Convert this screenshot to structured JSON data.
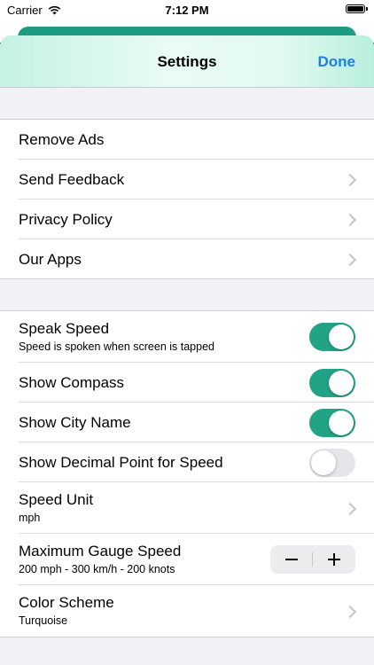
{
  "status_bar": {
    "carrier": "Carrier",
    "time": "7:12 PM"
  },
  "nav": {
    "title": "Settings",
    "done_label": "Done"
  },
  "groups": [
    {
      "items": [
        {
          "title": "Remove Ads",
          "chevron": false
        },
        {
          "title": "Send Feedback",
          "chevron": true
        },
        {
          "title": "Privacy Policy",
          "chevron": true
        },
        {
          "title": "Our Apps",
          "chevron": true
        }
      ]
    },
    {
      "items": [
        {
          "title": "Speak Speed",
          "subtitle": "Speed is spoken when screen is tapped",
          "control": "toggle",
          "on": true
        },
        {
          "title": "Show Compass",
          "control": "toggle",
          "on": true
        },
        {
          "title": "Show City Name",
          "control": "toggle",
          "on": true
        },
        {
          "title": "Show Decimal Point for Speed",
          "control": "toggle",
          "on": false
        },
        {
          "title": "Speed Unit",
          "subtitle": "mph",
          "control": "chevron"
        },
        {
          "title": "Maximum Gauge Speed",
          "subtitle": "200 mph - 300 km/h - 200 knots",
          "control": "stepper"
        },
        {
          "title": "Color Scheme",
          "subtitle": "Turquoise",
          "control": "chevron"
        }
      ]
    }
  ],
  "colors": {
    "accent": "#22a386",
    "link": "#1e7ee6",
    "background": "#f2f2f6"
  }
}
